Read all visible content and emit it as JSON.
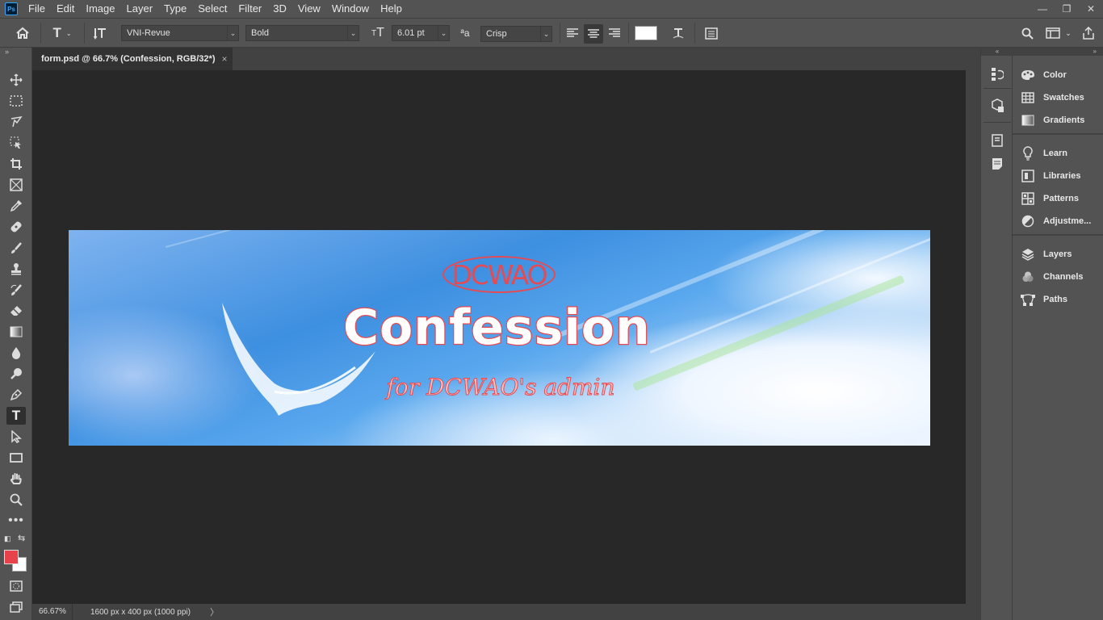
{
  "app": {
    "logo_text": "Ps"
  },
  "menu": [
    "File",
    "Edit",
    "Image",
    "Layer",
    "Type",
    "Select",
    "Filter",
    "3D",
    "View",
    "Window",
    "Help"
  ],
  "window_controls": {
    "minimize": "—",
    "restore": "❐",
    "close": "✕"
  },
  "options": {
    "font_family": "VNI-Revue",
    "font_style": "Bold",
    "font_size": "6.01 pt",
    "antialias_icon": "ªa",
    "antialias": "Crisp",
    "text_color": "#ffffff"
  },
  "document_tab": {
    "title": "form.psd @ 66.7% (Confession, RGB/32*)",
    "close": "×"
  },
  "artwork": {
    "logo": "DCWAO",
    "headline": "Confession",
    "subline": "for DCWAO's admin",
    "accent_color": "#e64a52"
  },
  "status": {
    "zoom": "66.67%",
    "doc_info": "1600 px x 400 px (1000 ppi)",
    "arrow": "〉"
  },
  "toolbar": {
    "foreground_color": "#e8424a",
    "background_color": "#ffffff",
    "active_tool": "type-tool"
  },
  "panels": {
    "group1": [
      "Color",
      "Swatches",
      "Gradients"
    ],
    "group2": [
      "Learn",
      "Libraries",
      "Patterns",
      "Adjustme..."
    ],
    "group3": [
      "Layers",
      "Channels",
      "Paths"
    ]
  }
}
